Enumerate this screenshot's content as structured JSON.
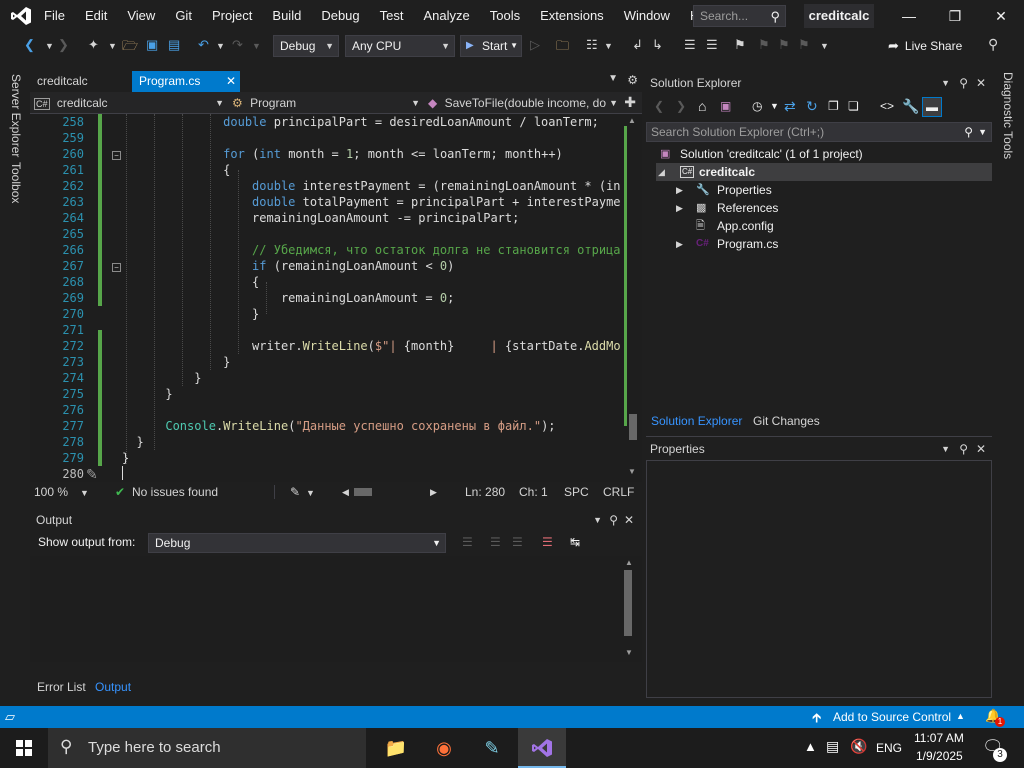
{
  "menu": {
    "items": [
      "File",
      "Edit",
      "View",
      "Git",
      "Project",
      "Build",
      "Debug",
      "Test",
      "Analyze",
      "Tools",
      "Extensions",
      "Window",
      "Help"
    ],
    "search_placeholder": "Search...",
    "solution_name": "creditcalc"
  },
  "toolbar": {
    "config": "Debug",
    "platform": "Any CPU",
    "start_label": "Start",
    "live_share": "Live Share"
  },
  "left_tabs": [
    "Server Explorer",
    "Toolbox"
  ],
  "right_tabs": [
    "Diagnostic Tools"
  ],
  "doc_tabs": [
    {
      "label": "creditcalc",
      "active": false
    },
    {
      "label": "Program.cs",
      "active": true
    }
  ],
  "navbar": {
    "project": "creditcalc",
    "class": "Program",
    "member": "SaveToFile(double income, do"
  },
  "editor": {
    "line_numbers": [
      "258",
      "259",
      "260",
      "261",
      "262",
      "263",
      "264",
      "265",
      "266",
      "267",
      "268",
      "269",
      "270",
      "271",
      "272",
      "273",
      "274",
      "275",
      "276",
      "277",
      "278",
      "279",
      "280"
    ],
    "current_line": "280"
  },
  "editor_status": {
    "zoom": "100 %",
    "issues": "No issues found",
    "line": "Ln: 280",
    "col": "Ch: 1",
    "whitespace": "SPC",
    "line_ending": "CRLF"
  },
  "output": {
    "title": "Output",
    "show_from_label": "Show output from:",
    "source": "Debug"
  },
  "bottom_tabs": [
    "Error List",
    "Output"
  ],
  "solution_explorer": {
    "title": "Solution Explorer",
    "search_placeholder": "Search Solution Explorer (Ctrl+;)",
    "solution_node": "Solution 'creditcalc' (1 of 1 project)",
    "project_node": "creditcalc",
    "children": [
      "Properties",
      "References",
      "App.config",
      "Program.cs"
    ],
    "tabs": [
      "Solution Explorer",
      "Git Changes"
    ]
  },
  "properties": {
    "title": "Properties"
  },
  "statusbar": {
    "source_control": "Add to Source Control",
    "notifications": "1"
  },
  "taskbar": {
    "search_placeholder": "Type here to search",
    "language": "ENG",
    "time": "11:07 AM",
    "date": "1/9/2025",
    "notification_count": "3"
  },
  "colors": {
    "accent": "#007acc",
    "editor_bg": "#1e1e1e",
    "chrome_bg": "#1f1f1f"
  }
}
